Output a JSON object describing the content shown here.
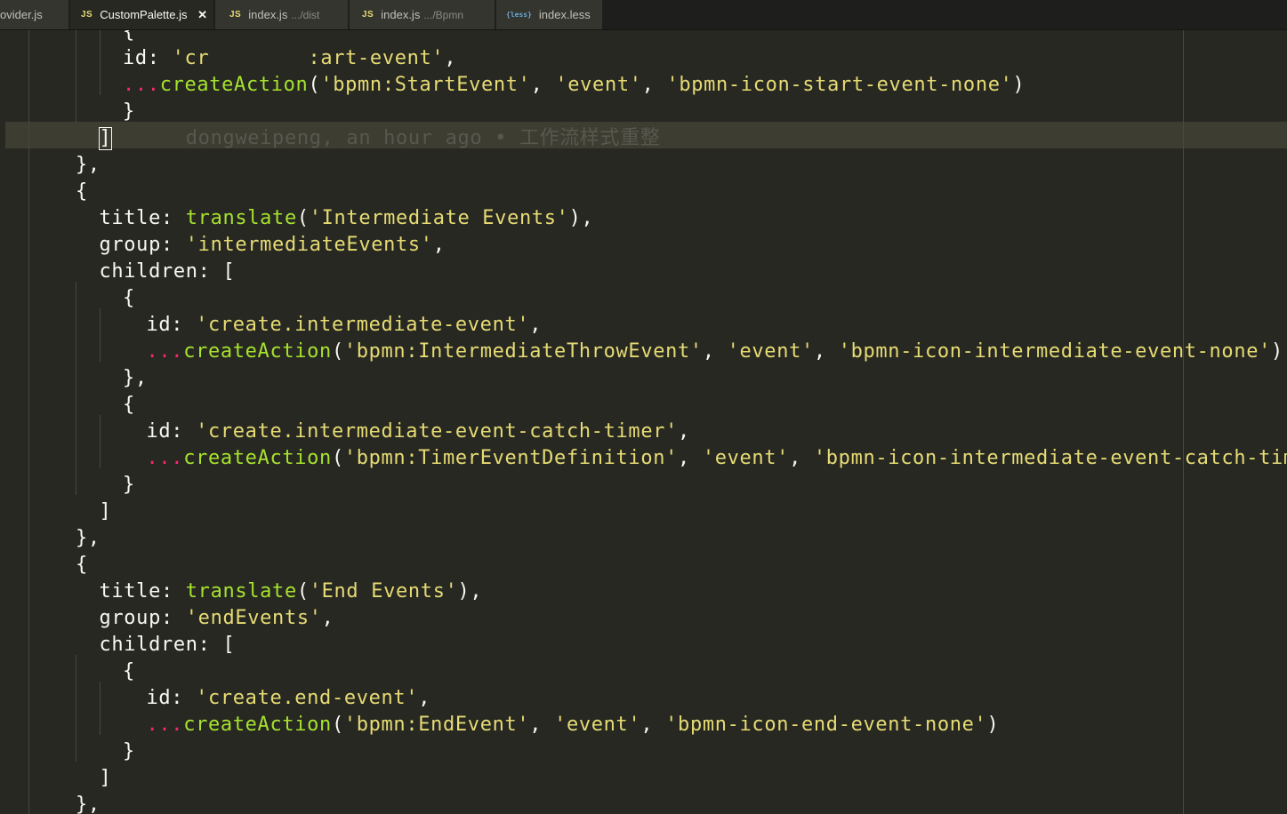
{
  "tabs": [
    {
      "label": "ovider.js",
      "desc": "",
      "icon": "",
      "active": false
    },
    {
      "label": "CustomPalette.js",
      "desc": "",
      "icon": "JS",
      "active": true,
      "close": "✕"
    },
    {
      "label": "index.js",
      "desc": ".../dist",
      "icon": "JS",
      "active": false
    },
    {
      "label": "index.js",
      "desc": ".../Bpmn",
      "icon": "JS",
      "active": false
    },
    {
      "label": "index.less",
      "desc": "",
      "icon": "{less}",
      "active": false
    }
  ],
  "editor": {
    "blame": "dongweipeng, an hour ago • 工作流样式重整",
    "colors": {
      "background": "#272822",
      "string": "#e6db74",
      "function": "#a6e22e",
      "spread": "#f92672",
      "text": "#f8f8f2"
    },
    "lines": [
      {
        "tokens": [
          {
            "t": "{",
            "c": ""
          }
        ]
      },
      {
        "tokens": [
          {
            "t": "id: ",
            "c": ""
          },
          {
            "t": "'cr",
            "c": "s"
          },
          {
            "t": "        ",
            "c": ""
          },
          {
            "t": ":art-event'",
            "c": "s"
          },
          {
            "t": ",",
            "c": ""
          }
        ]
      },
      {
        "tokens": [
          {
            "t": "...",
            "c": "sp"
          },
          {
            "t": "createAction",
            "c": "f"
          },
          {
            "t": "(",
            "c": ""
          },
          {
            "t": "'bpmn:StartEvent'",
            "c": "s"
          },
          {
            "t": ", ",
            "c": ""
          },
          {
            "t": "'event'",
            "c": "s"
          },
          {
            "t": ", ",
            "c": ""
          },
          {
            "t": "'bpmn-icon-start-event-none'",
            "c": "s"
          },
          {
            "t": ")",
            "c": ""
          }
        ]
      },
      {
        "tokens": [
          {
            "t": "}",
            "c": ""
          }
        ]
      },
      {
        "tokens": [
          {
            "t": "]",
            "c": "cursor"
          },
          {
            "t": "      ",
            "c": ""
          },
          {
            "t": "dongweipeng, an hour ago • 工作流样式重整",
            "c": "blame"
          }
        ]
      },
      {
        "tokens": [
          {
            "t": "},",
            "c": ""
          }
        ]
      },
      {
        "tokens": [
          {
            "t": "{",
            "c": ""
          }
        ]
      },
      {
        "tokens": [
          {
            "t": "title: ",
            "c": ""
          },
          {
            "t": "translate",
            "c": "f"
          },
          {
            "t": "(",
            "c": ""
          },
          {
            "t": "'Intermediate Events'",
            "c": "s"
          },
          {
            "t": "),",
            "c": ""
          }
        ]
      },
      {
        "tokens": [
          {
            "t": "group: ",
            "c": ""
          },
          {
            "t": "'intermediateEvents'",
            "c": "s"
          },
          {
            "t": ",",
            "c": ""
          }
        ]
      },
      {
        "tokens": [
          {
            "t": "children: [",
            "c": ""
          }
        ]
      },
      {
        "tokens": [
          {
            "t": "{",
            "c": ""
          }
        ]
      },
      {
        "tokens": [
          {
            "t": "id: ",
            "c": ""
          },
          {
            "t": "'create.intermediate-event'",
            "c": "s"
          },
          {
            "t": ",",
            "c": ""
          }
        ]
      },
      {
        "tokens": [
          {
            "t": "...",
            "c": "sp"
          },
          {
            "t": "createAction",
            "c": "f"
          },
          {
            "t": "(",
            "c": ""
          },
          {
            "t": "'bpmn:IntermediateThrowEvent'",
            "c": "s"
          },
          {
            "t": ", ",
            "c": ""
          },
          {
            "t": "'event'",
            "c": "s"
          },
          {
            "t": ", ",
            "c": ""
          },
          {
            "t": "'bpmn-icon-intermediate-event-none'",
            "c": "s"
          },
          {
            "t": ")",
            "c": ""
          }
        ]
      },
      {
        "tokens": [
          {
            "t": "},",
            "c": ""
          }
        ]
      },
      {
        "tokens": [
          {
            "t": "{",
            "c": ""
          }
        ]
      },
      {
        "tokens": [
          {
            "t": "id: ",
            "c": ""
          },
          {
            "t": "'create.intermediate-event-catch-timer'",
            "c": "s"
          },
          {
            "t": ",",
            "c": ""
          }
        ]
      },
      {
        "tokens": [
          {
            "t": "...",
            "c": "sp"
          },
          {
            "t": "createAction",
            "c": "f"
          },
          {
            "t": "(",
            "c": ""
          },
          {
            "t": "'bpmn:TimerEventDefinition'",
            "c": "s"
          },
          {
            "t": ", ",
            "c": ""
          },
          {
            "t": "'event'",
            "c": "s"
          },
          {
            "t": ", ",
            "c": ""
          },
          {
            "t": "'bpmn-icon-intermediate-event-catch-timer'",
            "c": "s"
          },
          {
            "t": ")",
            "c": ""
          }
        ]
      },
      {
        "tokens": [
          {
            "t": "}",
            "c": ""
          }
        ]
      },
      {
        "tokens": [
          {
            "t": "]",
            "c": ""
          }
        ]
      },
      {
        "tokens": [
          {
            "t": "},",
            "c": ""
          }
        ]
      },
      {
        "tokens": [
          {
            "t": "{",
            "c": ""
          }
        ]
      },
      {
        "tokens": [
          {
            "t": "title: ",
            "c": ""
          },
          {
            "t": "translate",
            "c": "f"
          },
          {
            "t": "(",
            "c": ""
          },
          {
            "t": "'End Events'",
            "c": "s"
          },
          {
            "t": "),",
            "c": ""
          }
        ]
      },
      {
        "tokens": [
          {
            "t": "group: ",
            "c": ""
          },
          {
            "t": "'endEvents'",
            "c": "s"
          },
          {
            "t": ",",
            "c": ""
          }
        ]
      },
      {
        "tokens": [
          {
            "t": "children: [",
            "c": ""
          }
        ]
      },
      {
        "tokens": [
          {
            "t": "{",
            "c": ""
          }
        ]
      },
      {
        "tokens": [
          {
            "t": "id: ",
            "c": ""
          },
          {
            "t": "'create.end-event'",
            "c": "s"
          },
          {
            "t": ",",
            "c": ""
          }
        ]
      },
      {
        "tokens": [
          {
            "t": "...",
            "c": "sp"
          },
          {
            "t": "createAction",
            "c": "f"
          },
          {
            "t": "(",
            "c": ""
          },
          {
            "t": "'bpmn:EndEvent'",
            "c": "s"
          },
          {
            "t": ", ",
            "c": ""
          },
          {
            "t": "'event'",
            "c": "s"
          },
          {
            "t": ", ",
            "c": ""
          },
          {
            "t": "'bpmn-icon-end-event-none'",
            "c": "s"
          },
          {
            "t": ")",
            "c": ""
          }
        ]
      },
      {
        "tokens": [
          {
            "t": "}",
            "c": ""
          }
        ]
      },
      {
        "tokens": [
          {
            "t": "]",
            "c": ""
          }
        ]
      },
      {
        "tokens": [
          {
            "t": "},",
            "c": ""
          }
        ]
      }
    ]
  }
}
